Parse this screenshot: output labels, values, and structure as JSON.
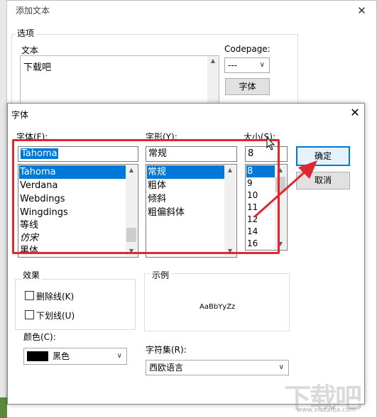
{
  "background_dialog": {
    "title": "添加文本",
    "close_glyph": "✕",
    "options_group_label": "选项",
    "text_label": "文本",
    "text_value": "下载吧",
    "codepage_label": "Codepage:",
    "codepage_value": "---",
    "font_button_label": "字体"
  },
  "font_dialog": {
    "title": "字体",
    "close_glyph": "✕",
    "font_label": "字体(F):",
    "font_value": "Tahoma",
    "font_list": [
      "Tahoma",
      "Verdana",
      "Webdings",
      "Wingdings",
      "等线",
      "仿宋",
      "黑体"
    ],
    "font_selected": "Tahoma",
    "style_label": "字形(Y):",
    "style_value": "常规",
    "style_list": [
      "常规",
      "粗体",
      "倾斜",
      "粗偏斜体"
    ],
    "style_selected": "常规",
    "size_label": "大小(S):",
    "size_value": "8",
    "size_list": [
      "8",
      "9",
      "10",
      "11",
      "12",
      "14",
      "16"
    ],
    "size_selected": "8",
    "ok_button": "确定",
    "cancel_button": "取消",
    "effects_label": "效果",
    "strikeout_label": "删除线(K)",
    "underline_label": "下划线(U)",
    "color_label": "颜色(C):",
    "color_value": "黑色",
    "color_swatch": "#000000",
    "sample_label": "示例",
    "sample_text": "AaBbYyZz",
    "charset_label": "字符集(R):",
    "charset_value": "西欧语言"
  },
  "annotation": {
    "highlight_color": "#e0262f"
  },
  "watermark": {
    "text": "下载吧",
    "url_text": "www.xiazaiba.com"
  }
}
